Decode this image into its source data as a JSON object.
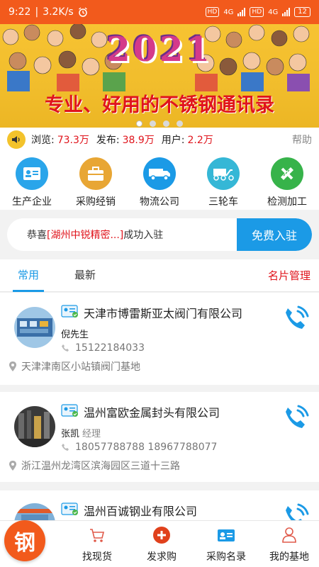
{
  "status_bar": {
    "time": "9:22",
    "speed": "3.2K/s",
    "hd1": "HD",
    "net1": "4G",
    "hd2": "HD",
    "net2": "4G",
    "battery": "12"
  },
  "banner": {
    "year": "2021",
    "slogan": "专业、好用的不锈钢通讯录",
    "dots": 4,
    "active_dot": 0
  },
  "stats": {
    "views_label": "浏览:",
    "views_value": "73.3万",
    "posts_label": "发布:",
    "posts_value": "38.9万",
    "users_label": "用户:",
    "users_value": "2.2万",
    "help": "帮助"
  },
  "categories": [
    {
      "label": "生产企业",
      "icon": "factory-card-icon",
      "color": "#2aa5ea"
    },
    {
      "label": "采购经销",
      "icon": "briefcase-icon",
      "color": "#e8a634"
    },
    {
      "label": "物流公司",
      "icon": "truck-icon",
      "color": "#1b9ae6"
    },
    {
      "label": "三轮车",
      "icon": "tricycle-icon",
      "color": "#35b7d6"
    },
    {
      "label": "检测加工",
      "icon": "ruler-pencil-icon",
      "color": "#37b34a"
    }
  ],
  "ticker": {
    "prefix": "恭喜",
    "highlight": "[湖州中锐精密...]",
    "suffix": "成功入驻",
    "join_button": "免费入驻"
  },
  "tabs": {
    "common": "常用",
    "latest": "最新",
    "manage": "名片管理"
  },
  "listings": [
    {
      "company": "天津市博雷斯亚太阀门有限公司",
      "contact": "倪先生",
      "role": "",
      "phone": "15122184033",
      "address": "天津津南区小站镇阀门基地"
    },
    {
      "company": "温州富欧金属封头有限公司",
      "contact": "张凯",
      "role": "经理",
      "phone": "18057788788 18967788077",
      "address": "浙江温州龙湾区滨海园区三道十三路"
    },
    {
      "company": "温州百诚钢业有限公司",
      "contact": "",
      "role": "",
      "phone": "",
      "address": ""
    }
  ],
  "bottom_nav": {
    "fab_label": "钢",
    "items": [
      {
        "label": "找现货",
        "icon": "cart-icon"
      },
      {
        "label": "发求购",
        "icon": "plus-circle-icon"
      },
      {
        "label": "采购名录",
        "icon": "contact-card-icon"
      },
      {
        "label": "我的基地",
        "icon": "user-icon"
      }
    ]
  },
  "colors": {
    "brand_orange": "#f25a1c",
    "accent_blue": "#1b9ae6",
    "highlight_red": "#e0141c"
  }
}
